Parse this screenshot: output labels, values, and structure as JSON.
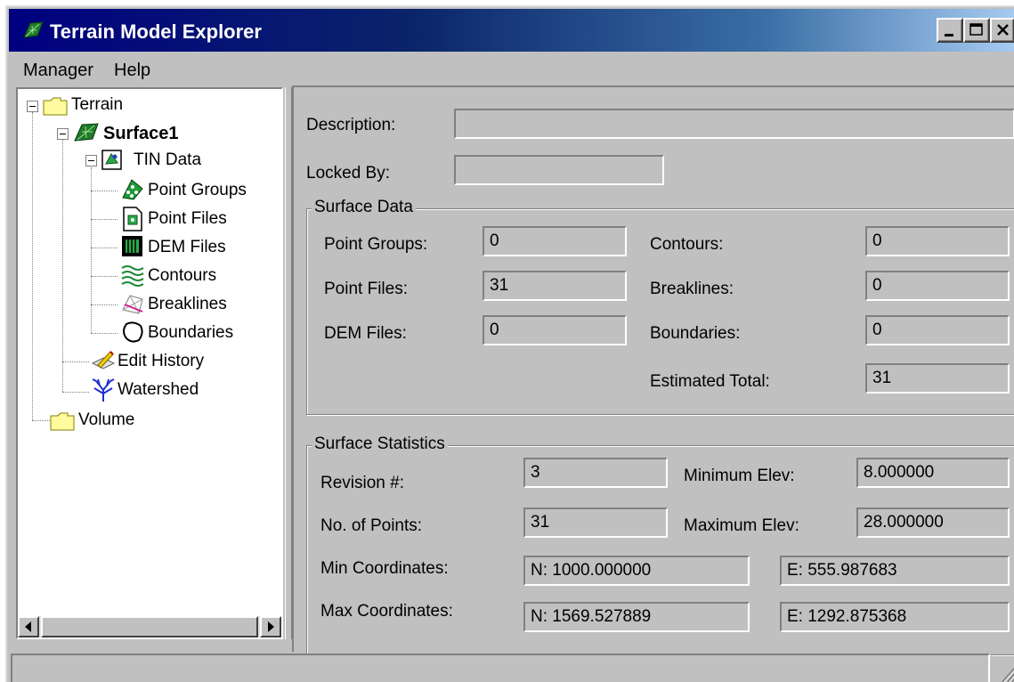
{
  "window": {
    "title": "Terrain Model Explorer",
    "icon": "terrain-leaf-icon",
    "title_bar_color": "#000080"
  },
  "menu": {
    "items": [
      "Manager",
      "Help"
    ]
  },
  "tree": {
    "nodes": [
      {
        "label": "Terrain",
        "icon": "folder-icon",
        "expanded": true
      },
      {
        "label": "Surface1",
        "icon": "surface-icon",
        "expanded": true,
        "selected": true
      },
      {
        "label": "TIN Data",
        "icon": "tin-data-icon",
        "expanded": true
      },
      {
        "label": "Point Groups",
        "icon": "point-groups-icon"
      },
      {
        "label": "Point Files",
        "icon": "point-files-icon"
      },
      {
        "label": "DEM Files",
        "icon": "dem-files-icon"
      },
      {
        "label": "Contours",
        "icon": "contours-icon"
      },
      {
        "label": "Breaklines",
        "icon": "breaklines-icon"
      },
      {
        "label": "Boundaries",
        "icon": "boundaries-icon"
      },
      {
        "label": "Edit History",
        "icon": "edit-history-icon"
      },
      {
        "label": "Watershed",
        "icon": "watershed-icon"
      },
      {
        "label": "Volume",
        "icon": "folder-icon"
      }
    ]
  },
  "details": {
    "description_label": "Description:",
    "description_value": "",
    "locked_by_label": "Locked By:",
    "locked_by_value": "",
    "surface_data": {
      "title": "Surface Data",
      "point_groups_label": "Point Groups:",
      "point_groups_value": "0",
      "point_files_label": "Point Files:",
      "point_files_value": "31",
      "dem_files_label": "DEM Files:",
      "dem_files_value": "0",
      "contours_label": "Contours:",
      "contours_value": "0",
      "breaklines_label": "Breaklines:",
      "breaklines_value": "0",
      "boundaries_label": "Boundaries:",
      "boundaries_value": "0",
      "estimated_total_label": "Estimated Total:",
      "estimated_total_value": "31"
    },
    "surface_statistics": {
      "title": "Surface Statistics",
      "revision_label": "Revision #:",
      "revision_value": "3",
      "num_points_label": "No. of Points:",
      "num_points_value": "31",
      "min_elev_label": "Minimum Elev:",
      "min_elev_value": "8.000000",
      "max_elev_label": "Maximum Elev:",
      "max_elev_value": "28.000000",
      "min_coords_label": "Min Coordinates:",
      "min_coords_n": "N: 1000.000000",
      "min_coords_e": "E: 555.987683",
      "max_coords_label": "Max Coordinates:",
      "max_coords_n": "N: 1569.527889",
      "max_coords_e": "E: 1292.875368"
    }
  },
  "statusbar": {
    "text": ""
  }
}
